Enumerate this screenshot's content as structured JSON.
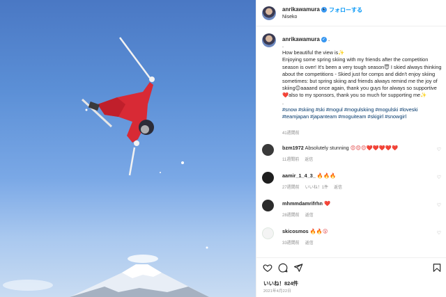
{
  "post": {
    "author": "anrikawamura",
    "follow_label": "フォローする",
    "location": "Niseko",
    "separator": "•"
  },
  "caption": {
    "author": "anrikawamura",
    "dot": ".",
    "line_dot": ".",
    "text1": "How beautiful the view is✨",
    "text2": "Enjoying some spring skiing with my friends after the competition season is over! It's been a very tough season😇 I skied always thinking about the competitions - Skied just for comps and didn't enjoy skiing sometimes: but spring skiing and friends always remind me the joy of skiing😊aaaand once again, thank you guys for always so supportive❤️also to my sponsors, thank you so much for supporting me✨",
    "line_dot2": ".",
    "hashtags": "#snow #skiing #ski #mogul #mogulskiing #mogulski #loveski #teamjapan #japanteam #moguiteam #skigirl #snowgirl",
    "time": "41週間前"
  },
  "comments": [
    {
      "user": "bzm1972",
      "text": "Absolutely stunning",
      "emoji": "😍😍😍❤️❤️❤️❤️❤️",
      "time": "11週間前",
      "reply": "返信"
    },
    {
      "user": "aamir_1_4_3_",
      "text": "",
      "emoji": "🔥🔥🔥",
      "time": "27週間前",
      "likes": "いいね！1件",
      "reply": "返信"
    },
    {
      "user": "mhmmdamrifrhn",
      "text": "",
      "emoji": "❤️",
      "time": "28週間前",
      "reply": "返信"
    },
    {
      "user": "skicosmos",
      "text": "",
      "emoji": "🔥🔥😮",
      "time": "33週間前",
      "reply": "返信"
    }
  ],
  "icons": [
    "heart-icon",
    "comment-icon",
    "share-icon",
    "bookmark-icon"
  ],
  "likes": "いいね！824件",
  "date": "2021年4月22日",
  "colors": {
    "accent": "#0095f6",
    "verified": "#3897f0",
    "muted": "#8e8e8e",
    "hashtag": "#00376b"
  }
}
